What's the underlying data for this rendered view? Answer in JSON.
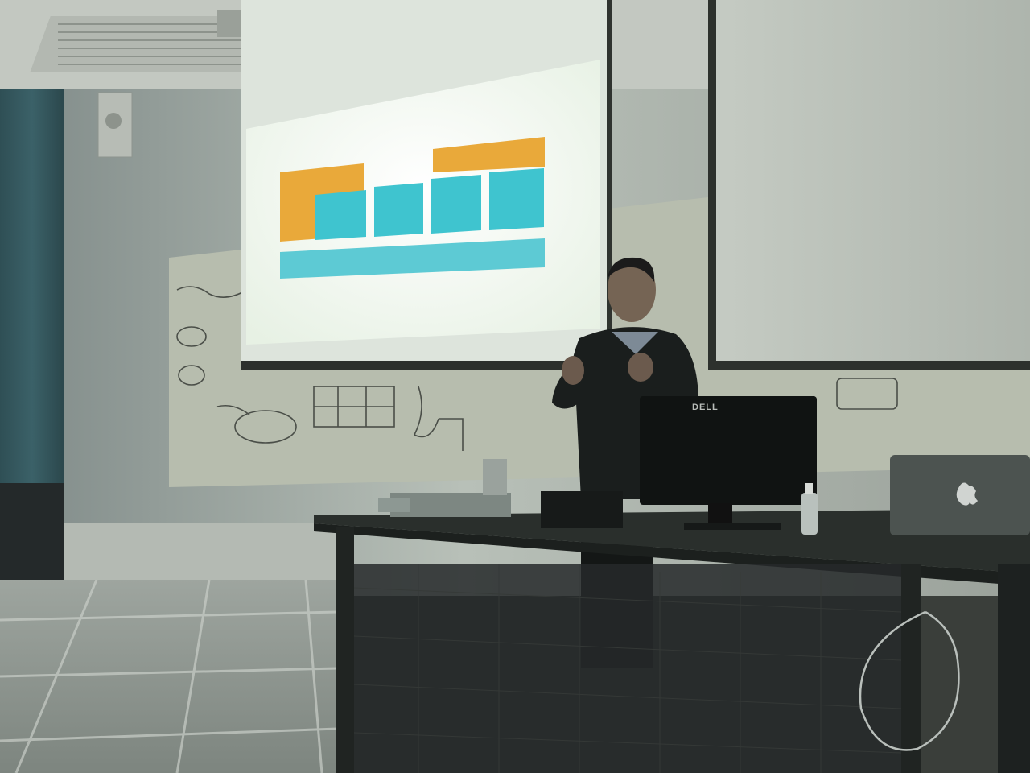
{
  "scene": {
    "description_free": true,
    "wall_color": "#cfd3cb",
    "floor_color": "#8e958e",
    "screen_glow_color": "#f6fbf4",
    "slide_colors": {
      "orange": "#e9a93a",
      "teal": "#3fc4cf",
      "light_teal": "#7fd5de"
    },
    "monitor_brand": "DELL"
  }
}
